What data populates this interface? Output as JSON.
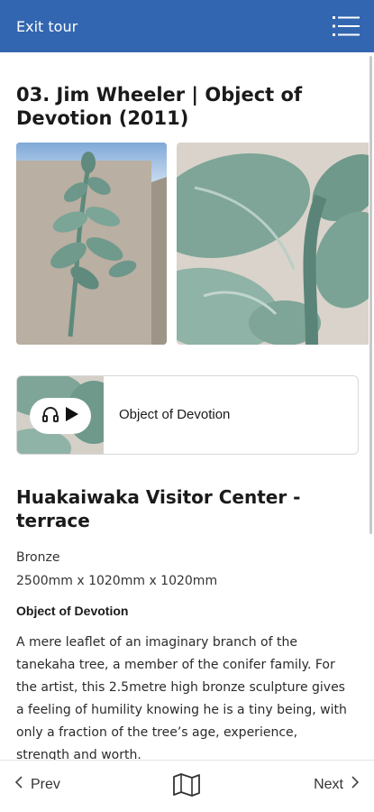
{
  "header": {
    "exit_label": "Exit tour",
    "menu_icon": "hamburger-menu-icon",
    "background": "#3366b0"
  },
  "stop": {
    "title": "03. Jim Wheeler | Object of Devotion (2011)",
    "images": [
      {
        "icon": "sculpture-photo-wall"
      },
      {
        "icon": "sculpture-photo-closeup"
      }
    ],
    "audio": {
      "title": "Object of Devotion",
      "headphones_icon": "headphones-icon",
      "play_icon": "play-icon"
    },
    "location": "Huakaiwaka Visitor Center - terrace",
    "material": "Bronze",
    "dimensions": "2500mm x 1020mm x 1020mm",
    "description_heading": "Object of Devotion",
    "description": "A mere leaflet of an imaginary branch of the tanekaha tree, a member of the conifer family. For the artist, this 2.5metre high bronze sculpture gives a feeling of humility knowing he is a tiny being, with only a fraction of the tree’s age, experience, strength and worth."
  },
  "footer": {
    "prev_label": "Prev",
    "next_label": "Next",
    "map_icon": "map-icon"
  }
}
